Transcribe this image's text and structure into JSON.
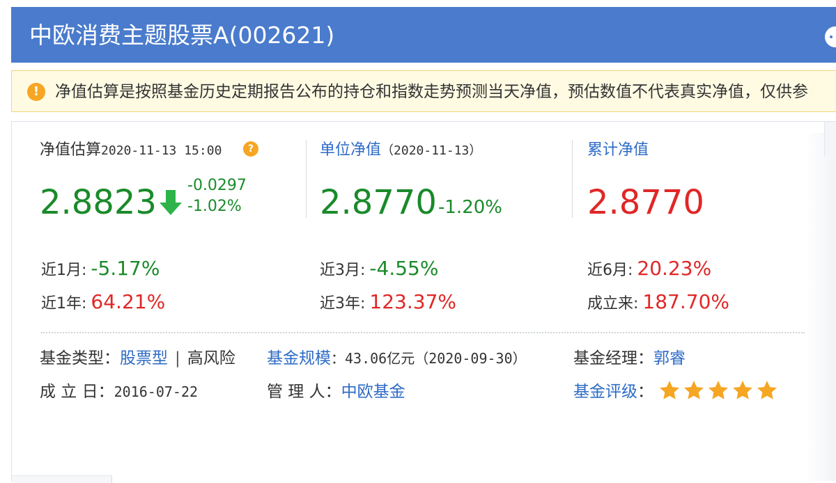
{
  "header": {
    "title": "中欧消费主题股票A(002621)"
  },
  "notice": {
    "icon": "info-icon",
    "text": "净值估算是按照基金历史定期报告公布的持仓和指数走势预测当天净值，预估数值不代表真实净值，仅供参"
  },
  "estimate": {
    "label": "净值估算",
    "datetime": "2020-11-13 15:00",
    "value": "2.8823",
    "change": "-0.0297",
    "change_pct": "-1.02%",
    "direction": "down"
  },
  "unit_nav": {
    "label": "单位净值",
    "date": "（2020-11-13）",
    "value": "2.8770",
    "change_pct": "-1.20%"
  },
  "cumulative_nav": {
    "label": "累计净值",
    "value": "2.8770"
  },
  "performance": [
    {
      "label": "近1月:",
      "value": "-5.17%"
    },
    {
      "label": "近3月:",
      "value": "-4.55%"
    },
    {
      "label": "近6月:",
      "value": "20.23%"
    },
    {
      "label": "近1年:",
      "value": "64.21%"
    },
    {
      "label": "近3年:",
      "value": "123.37%"
    },
    {
      "label": "成立来:",
      "value": "187.70%"
    }
  ],
  "info": {
    "fund_type_label": "基金类型：",
    "fund_type": "股票型",
    "separator": "|",
    "risk": "高风险",
    "scale_label": "基金规模",
    "scale_value": "：43.06亿元（2020-09-30）",
    "manager_label": "基金经理：",
    "manager": "郭睿",
    "inception_label": "成 立 日：",
    "inception_date": "2016-07-22",
    "custodian_label": "管 理 人：",
    "custodian": "中欧基金",
    "rating_label": "基金评级",
    "rating_colon": "：",
    "rating": 5
  },
  "colors": {
    "header_bg": "#4a7bcc",
    "rise": "#e02727",
    "fall": "#1a8a2a",
    "link": "#2e6bc6",
    "star": "#f6a623"
  }
}
